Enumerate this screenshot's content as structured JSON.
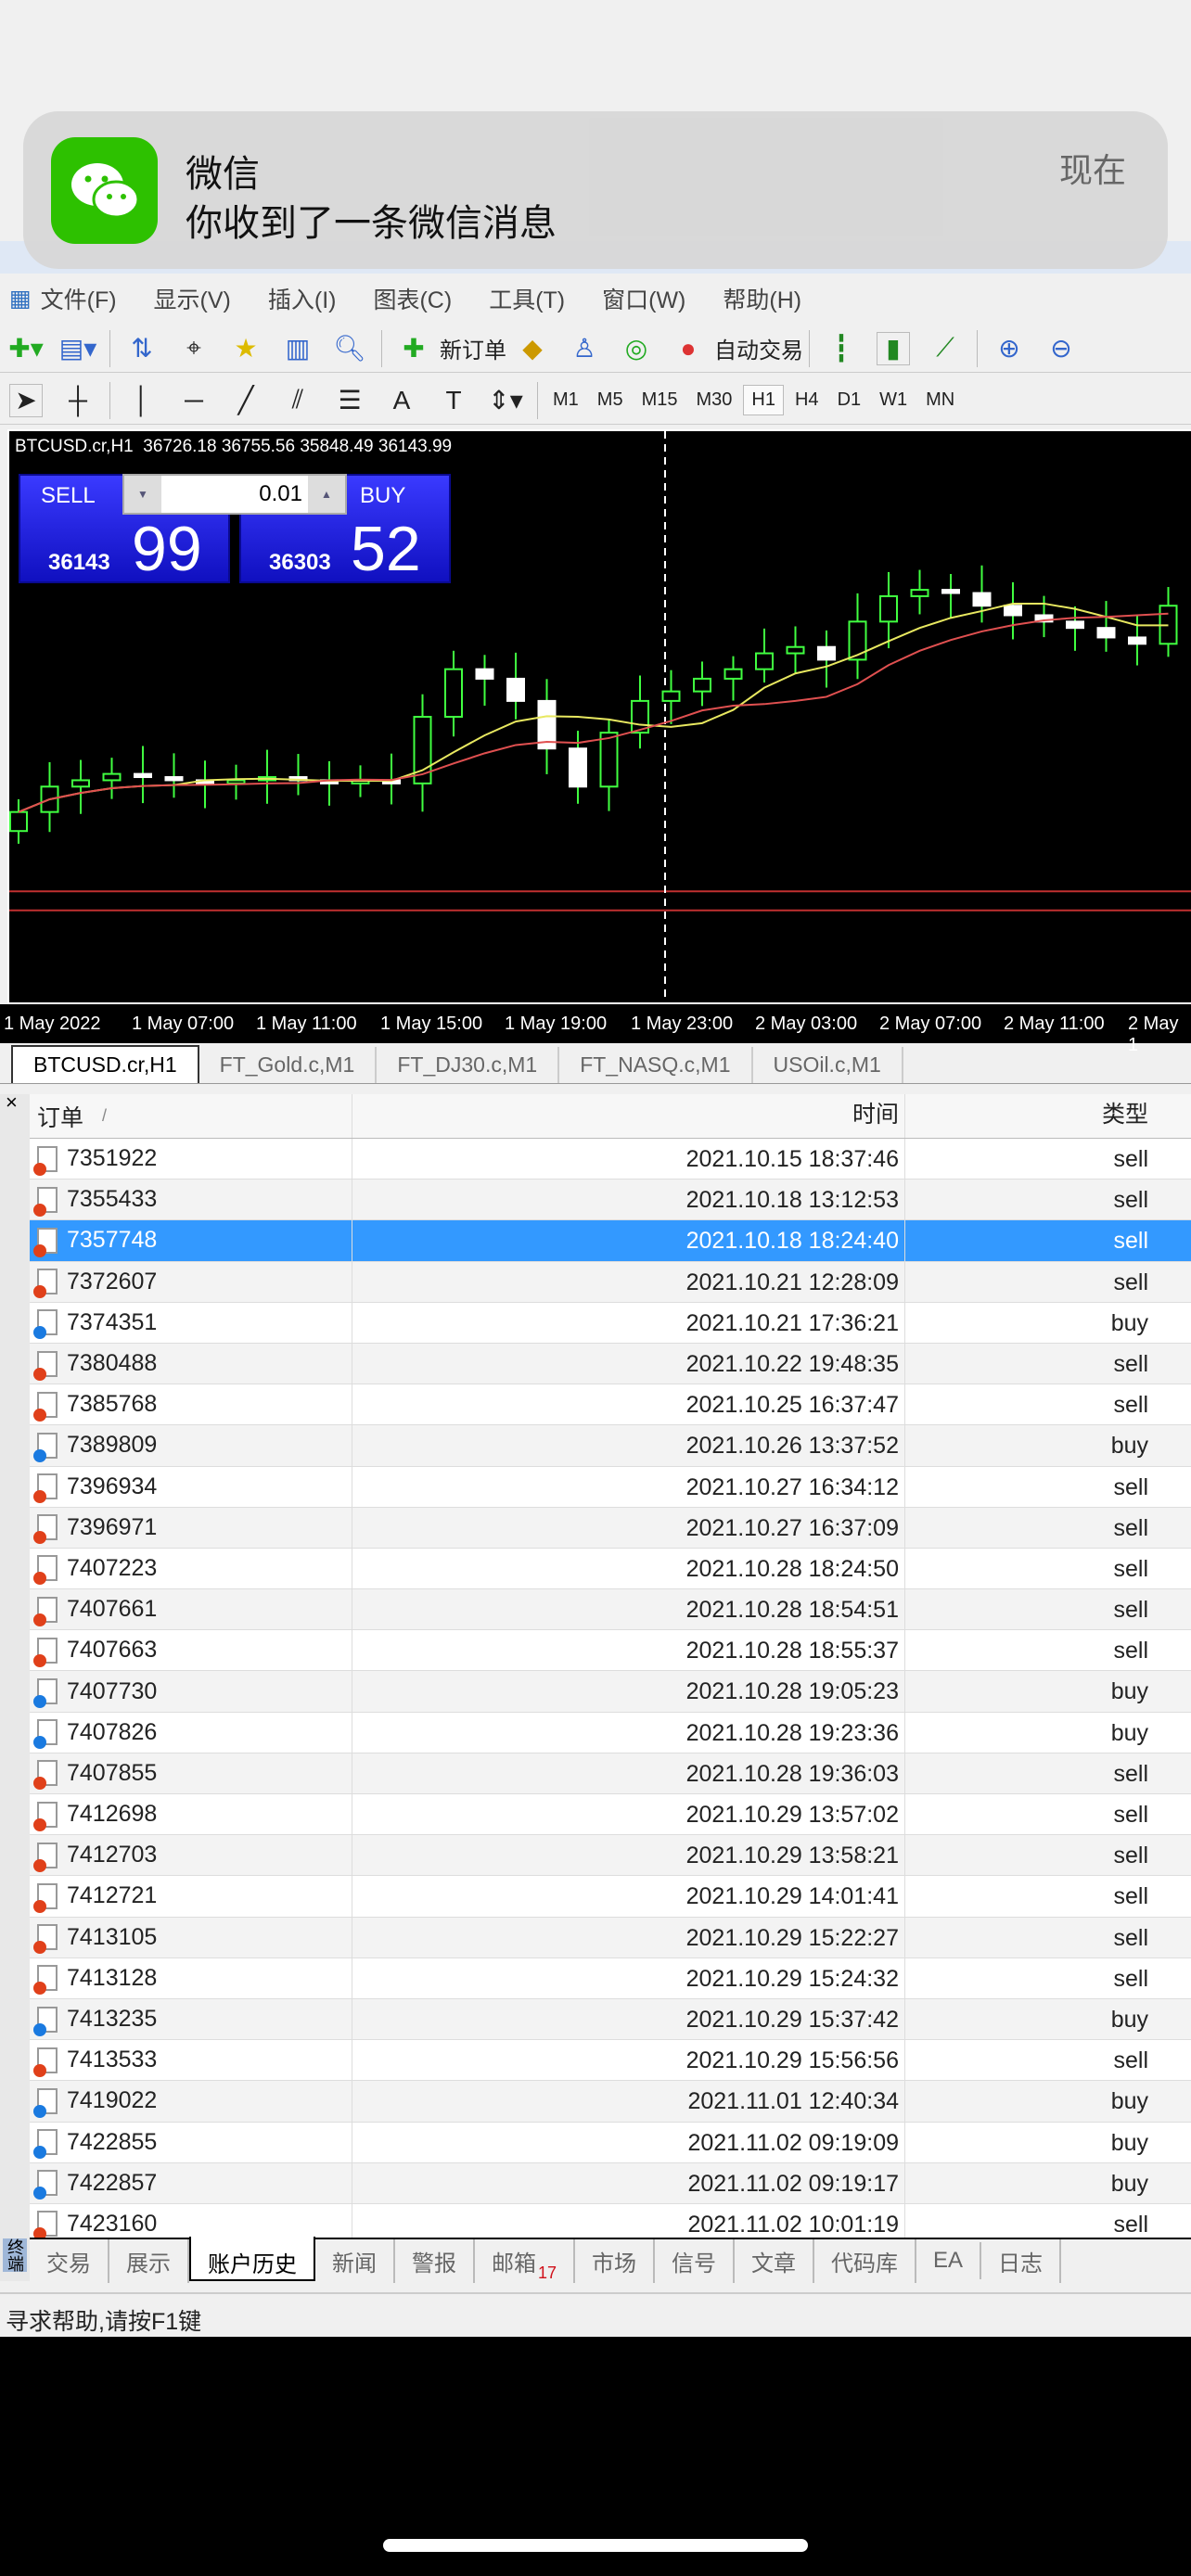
{
  "notification": {
    "app": "微信",
    "message": "你收到了一条微信消息",
    "time": "现在"
  },
  "menu": [
    "文件(F)",
    "显示(V)",
    "插入(I)",
    "图表(C)",
    "工具(T)",
    "窗口(W)",
    "帮助(H)"
  ],
  "toolbar": {
    "new_order": "新订单",
    "auto_trade": "自动交易"
  },
  "timeframes": [
    "M1",
    "M5",
    "M15",
    "M30",
    "H1",
    "H4",
    "D1",
    "W1",
    "MN"
  ],
  "active_timeframe": "H1",
  "chart": {
    "header": "BTCUSD.cr,H1  36726.18 36755.56 35848.49 36143.99",
    "sell_label": "SELL",
    "buy_label": "BUY",
    "lot": "0.01",
    "sell_price_small": "36143",
    "sell_price_big": "99",
    "buy_price_small": "36303",
    "buy_price_big": "52",
    "time_labels": [
      "1 May 2022",
      "1 May 07:00",
      "1 May 11:00",
      "1 May 15:00",
      "1 May 19:00",
      "1 May 23:00",
      "2 May 03:00",
      "2 May 07:00",
      "2 May 11:00",
      "2 May 1"
    ]
  },
  "chart_data": {
    "type": "candlestick",
    "ylim": [
      35400,
      37200
    ],
    "closes": [
      36000,
      36080,
      36100,
      36120,
      36110,
      36100,
      36090,
      36100,
      36110,
      36100,
      36090,
      36100,
      36090,
      36300,
      36450,
      36420,
      36350,
      36200,
      36080,
      36250,
      36350,
      36380,
      36420,
      36450,
      36500,
      36520,
      36480,
      36600,
      36680,
      36700,
      36690,
      36650,
      36620,
      36600,
      36580,
      36550,
      36530,
      36650
    ],
    "lines": [
      35750,
      35690
    ]
  },
  "chart_tabs": [
    "BTCUSD.cr,H1",
    "FT_Gold.c,M1",
    "FT_DJ30.c,M1",
    "FT_NASQ.c,M1",
    "USOil.c,M1"
  ],
  "table": {
    "headers": {
      "order": "订单",
      "sort": "/",
      "time": "时间",
      "type": "类型"
    },
    "rows": [
      [
        "7351922",
        "2021.10.15 18:37:46",
        "sell"
      ],
      [
        "7355433",
        "2021.10.18 13:12:53",
        "sell"
      ],
      [
        "7357748",
        "2021.10.18 18:24:40",
        "sell"
      ],
      [
        "7372607",
        "2021.10.21 12:28:09",
        "sell"
      ],
      [
        "7374351",
        "2021.10.21 17:36:21",
        "buy"
      ],
      [
        "7380488",
        "2021.10.22 19:48:35",
        "sell"
      ],
      [
        "7385768",
        "2021.10.25 16:37:47",
        "sell"
      ],
      [
        "7389809",
        "2021.10.26 13:37:52",
        "buy"
      ],
      [
        "7396934",
        "2021.10.27 16:34:12",
        "sell"
      ],
      [
        "7396971",
        "2021.10.27 16:37:09",
        "sell"
      ],
      [
        "7407223",
        "2021.10.28 18:24:50",
        "sell"
      ],
      [
        "7407661",
        "2021.10.28 18:54:51",
        "sell"
      ],
      [
        "7407663",
        "2021.10.28 18:55:37",
        "sell"
      ],
      [
        "7407730",
        "2021.10.28 19:05:23",
        "buy"
      ],
      [
        "7407826",
        "2021.10.28 19:23:36",
        "buy"
      ],
      [
        "7407855",
        "2021.10.28 19:36:03",
        "sell"
      ],
      [
        "7412698",
        "2021.10.29 13:57:02",
        "sell"
      ],
      [
        "7412703",
        "2021.10.29 13:58:21",
        "sell"
      ],
      [
        "7412721",
        "2021.10.29 14:01:41",
        "sell"
      ],
      [
        "7413105",
        "2021.10.29 15:22:27",
        "sell"
      ],
      [
        "7413128",
        "2021.10.29 15:24:32",
        "sell"
      ],
      [
        "7413235",
        "2021.10.29 15:37:42",
        "buy"
      ],
      [
        "7413533",
        "2021.10.29 15:56:56",
        "sell"
      ],
      [
        "7419022",
        "2021.11.01 12:40:34",
        "buy"
      ],
      [
        "7422855",
        "2021.11.02 09:19:09",
        "buy"
      ],
      [
        "7422857",
        "2021.11.02 09:19:17",
        "buy"
      ],
      [
        "7423160",
        "2021.11.02 10:01:19",
        "sell"
      ]
    ],
    "selected_index": 2
  },
  "bottom_tabs": [
    "交易",
    "展示",
    "账户历史",
    "新闻",
    "警报",
    "邮箱",
    "市场",
    "信号",
    "文章",
    "代码库",
    "EA",
    "日志"
  ],
  "mail_badge": "17",
  "active_bottom_tab": "账户历史",
  "side_label": "终端",
  "status": "寻求帮助,请按F1键",
  "colors": {
    "sell_dot": "#e0401a",
    "buy_dot": "#1a7ae0",
    "selected": "#3399ff",
    "bull": "#40ff40"
  }
}
